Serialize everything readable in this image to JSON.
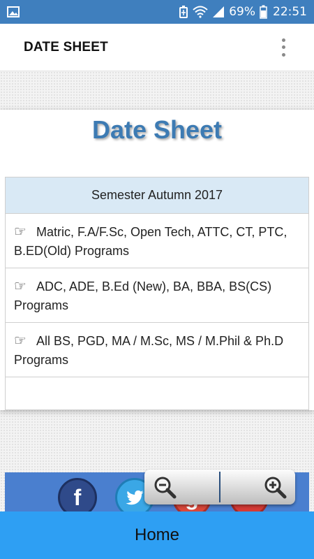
{
  "status_bar": {
    "battery_percent": "69%",
    "time": "22:51",
    "icons": [
      "image-icon",
      "battery-saver-icon",
      "wifi-icon",
      "signal-icon",
      "battery-icon"
    ]
  },
  "app_bar": {
    "title": "DATE SHEET",
    "menu_icon": "more-vert-icon"
  },
  "card": {
    "heading": "Date Sheet",
    "table": {
      "header": "Semester Autumn 2017",
      "rows": [
        {
          "icon": "hand-pointing-icon",
          "label": "Matric, F.A/F.Sc, Open Tech, ATTC, CT, PTC, B.ED(Old) Programs"
        },
        {
          "icon": "hand-pointing-icon",
          "label": "ADC, ADE, B.Ed (New), BA, BBA, BS(CS) Programs"
        },
        {
          "icon": "hand-pointing-icon",
          "label": "All BS, PGD, MA / M.Sc, MS / M.Phil & Ph.D Programs"
        }
      ]
    }
  },
  "social": {
    "facebook_glyph": "f",
    "googleplus_glyph": "g"
  },
  "bottom_bar": {
    "label": "Home"
  },
  "colors": {
    "status_bar": "#3f7fbe",
    "heading": "#3d7bb3",
    "table_header": "#d9e9f5",
    "bottom_bar": "#2e9ff3",
    "social_strip": "#4a7fcf"
  }
}
